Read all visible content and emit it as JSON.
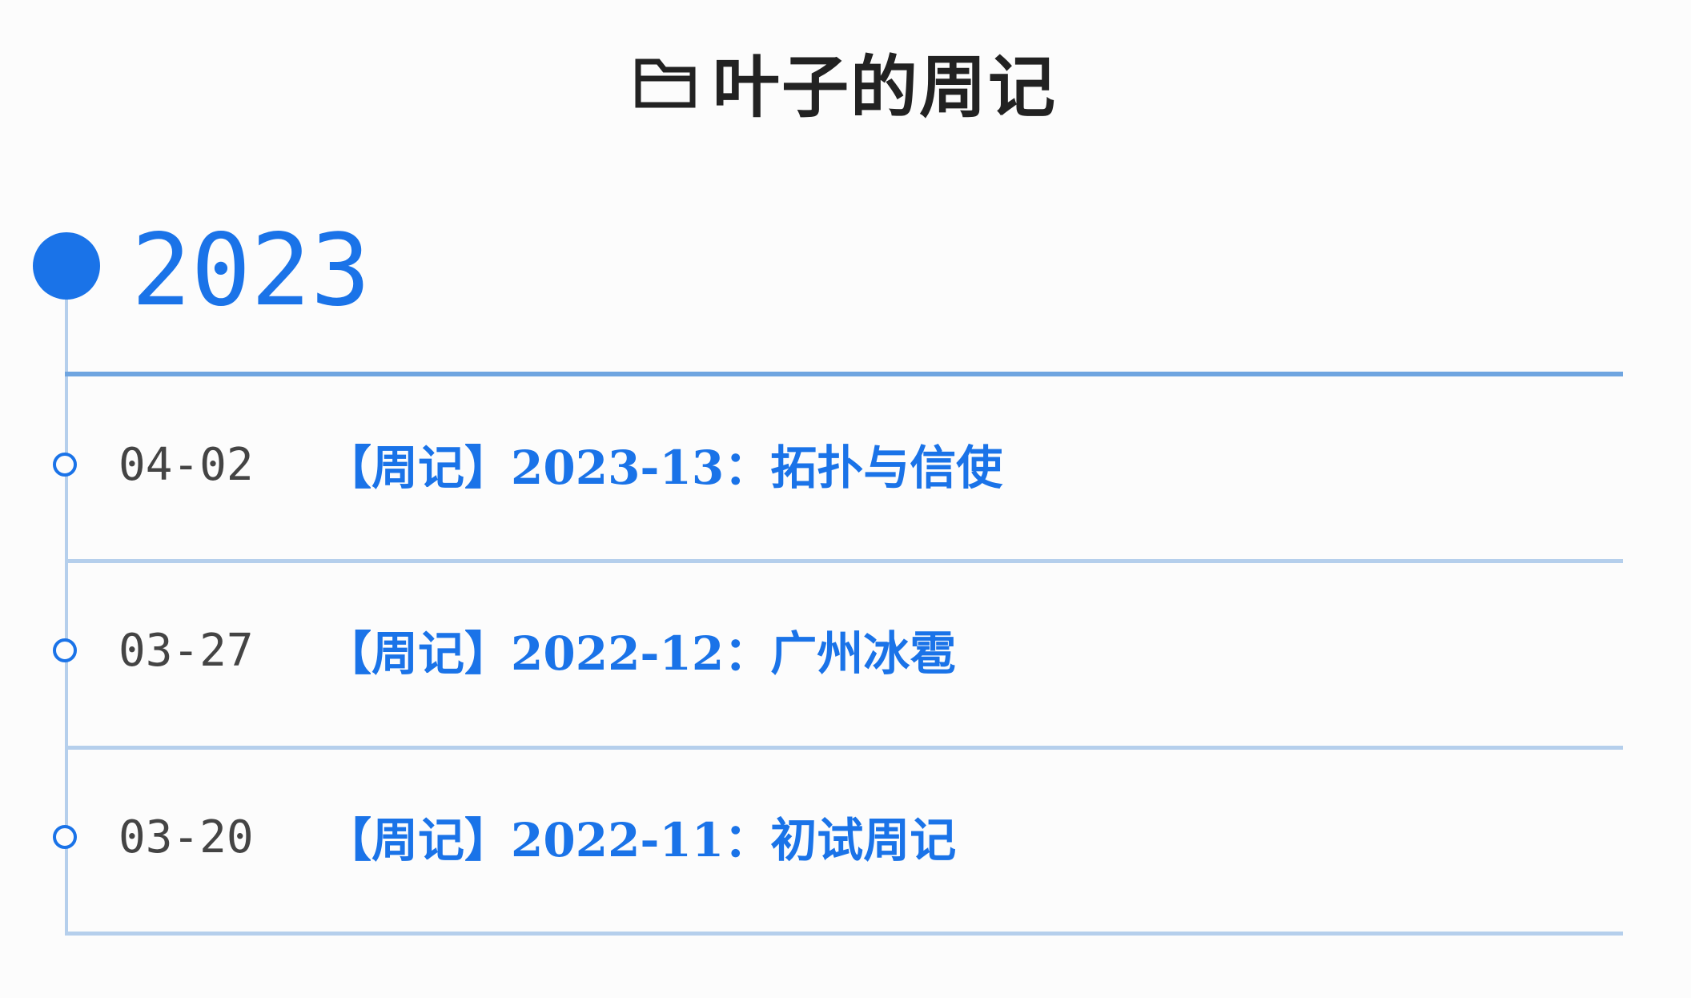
{
  "header": {
    "icon": "folder-icon",
    "title": "叶子的周记"
  },
  "timeline": {
    "year": "2023",
    "accent_color": "#1a73e8",
    "posts": [
      {
        "date": "04-02",
        "title": "【周记】2023-13：拓扑与信使"
      },
      {
        "date": "03-27",
        "title": "【周记】2022-12：广州冰雹"
      },
      {
        "date": "03-20",
        "title": "【周记】2022-11：初试周记"
      }
    ]
  }
}
